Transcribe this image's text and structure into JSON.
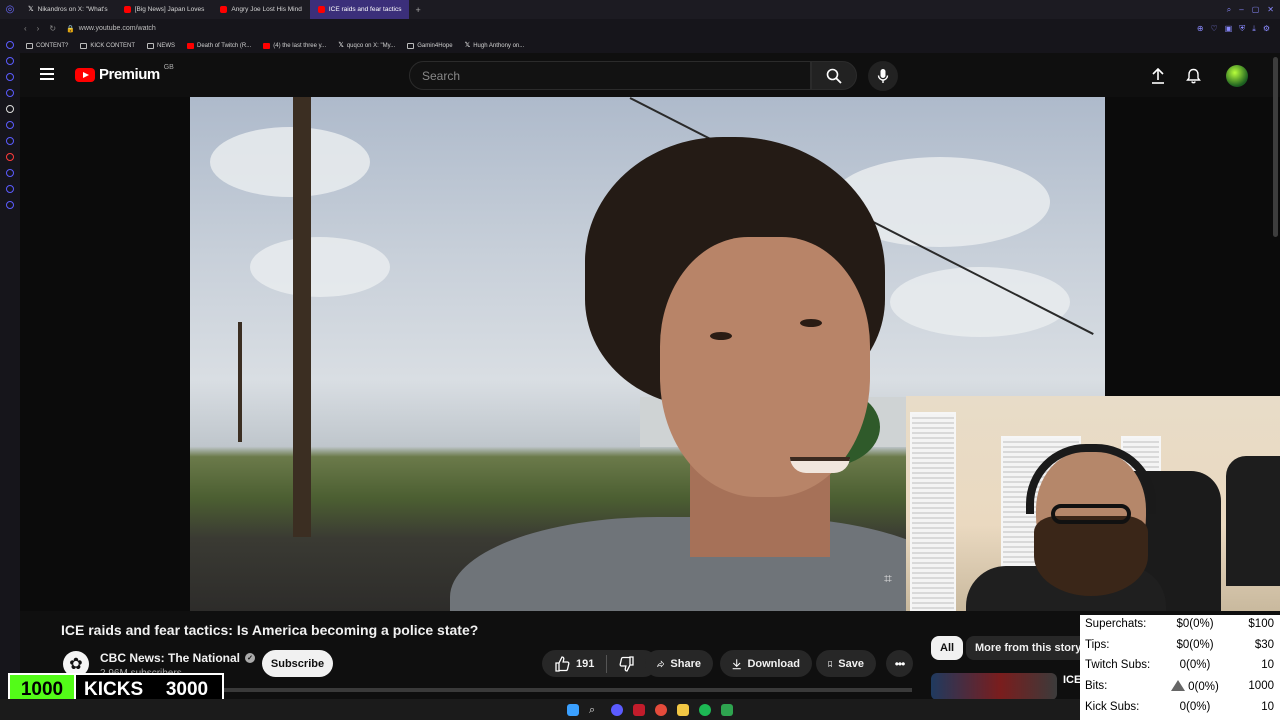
{
  "browser": {
    "tabs": [
      {
        "label": "Nikandros on X: \"What's",
        "icon": "x"
      },
      {
        "label": "[Big News] Japan Loves",
        "icon": "yt"
      },
      {
        "label": "Angry Joe Lost His Mind",
        "icon": "yt"
      },
      {
        "label": "ICE raids and fear tactics",
        "icon": "yt",
        "active": true
      }
    ],
    "url": "www.youtube.com/watch",
    "bookmarks": [
      {
        "label": "CONTENT?",
        "icon": "folder"
      },
      {
        "label": "KICK CONTENT",
        "icon": "folder"
      },
      {
        "label": "NEWS",
        "icon": "folder"
      },
      {
        "label": "Death of Twitch (R...",
        "icon": "yt"
      },
      {
        "label": "(4) the last three y...",
        "icon": "yt"
      },
      {
        "label": "quqco on X: \"My...",
        "icon": "x"
      },
      {
        "label": "Gamin4Hope",
        "icon": "folder"
      },
      {
        "label": "Hugh Anthony on...",
        "icon": "x"
      }
    ]
  },
  "youtube": {
    "logo_text": "Premium",
    "region": "GB",
    "search_placeholder": "Search",
    "video": {
      "title": "ICE raids and fear tactics: Is America becoming a police state?",
      "channel": "CBC News: The National",
      "subscribers": "2.96M subscribers",
      "subscribe_label": "Subscribe",
      "likes": "191",
      "share_label": "Share",
      "download_label": "Download",
      "save_label": "Save",
      "more_label": "•••",
      "progress": 0.0
    },
    "chips": {
      "all": "All",
      "story": "More from this story"
    },
    "next_video_text": "ICE"
  },
  "overlay": {
    "kicks": {
      "current": "1000",
      "label": "KICKS",
      "goal": "3000"
    },
    "stats": [
      {
        "label": "Superchats:",
        "value": "$0(0%)",
        "goal": "$100"
      },
      {
        "label": "Tips:",
        "value": "$0(0%)",
        "goal": "$30"
      },
      {
        "label": "Twitch Subs:",
        "value": "0(0%)",
        "goal": "10"
      },
      {
        "label": "Bits:",
        "value": "0(0%)",
        "goal": "1000"
      },
      {
        "label": "Kick Subs:",
        "value": "0(0%)",
        "goal": "10"
      }
    ]
  },
  "colors": {
    "youtube_red": "#ff0000",
    "kick_green": "#53fc18",
    "accent_tab": "#3b2f7a"
  }
}
